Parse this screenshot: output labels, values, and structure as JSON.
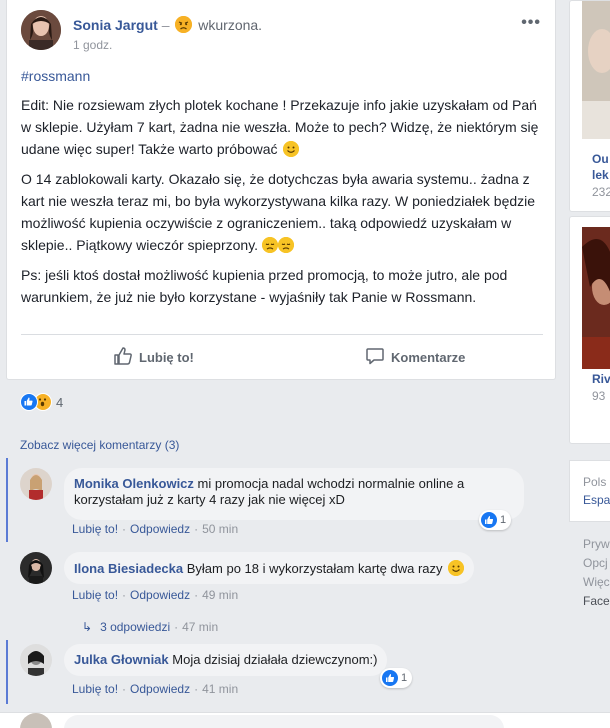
{
  "post": {
    "author": "Sonia Jargut",
    "feeling_dash": "–",
    "feeling": "wkurzona.",
    "timestamp": "1 godz.",
    "hashtag": "#rossmann",
    "paragraphs": [
      "Edit: Nie rozsiewam złych plotek kochane ! Przekazuje info jakie uzyskałam od Pań w sklepie. Użyłam 7 kart, żadna nie weszła. Może to pech? Widzę, że niektórym się udane więc super! Także warto próbować",
      "O 14 zablokowali karty. Okazało się, że dotychczas była awaria systemu.. żadna z kart nie weszła teraz mi, bo była wykorzystywana kilka razy. W poniedziałek będzie możliwość kupienia oczywiście z ograniczeniem.. taką odpowiedź uzyskałam w sklepie.. Piątkowy wieczór spieprzony.",
      "Ps: jeśli ktoś dostał możliwość kupienia przed promocją, to może jutro, ale pod warunkiem, że już nie było korzystane - wyjaśniły tak Panie w Rossmann."
    ],
    "like_label": "Lubię to!",
    "comment_label": "Komentarze",
    "reaction_count": "4"
  },
  "comments_section": {
    "more_comments": "Zobacz więcej komentarzy (3)",
    "action_like": "Lubię to!",
    "action_reply": "Odpowiedz",
    "sep": "·",
    "items": [
      {
        "name": "Monika Olenkowicz",
        "text": "mi promocja nadal wchodzi normalnie online a korzystałam już z karty 4 razy jak nie więcej xD",
        "time": "50 min",
        "likes": "1"
      },
      {
        "name": "Ilona Biesiadecka",
        "text": "Byłam po 18 i wykorzystałam kartę dwa razy",
        "time": "49 min"
      },
      {
        "name": "Julka Głowniak",
        "text": "Moja dzisiaj działała dziewczynom:)",
        "time": "41 min",
        "likes": "1"
      }
    ],
    "replies": {
      "label": "3 odpowiedzi",
      "sep": "·",
      "time": "47 min"
    }
  },
  "sidebar": {
    "card1": {
      "title_1": "Ou",
      "title_2": "lek",
      "sub": "232"
    },
    "card2": {
      "title": "Riv",
      "sub": "93"
    },
    "lang": {
      "line1": "Pols",
      "line2": "Espa"
    },
    "footer": [
      "Pryw",
      "Opcj",
      "Więc",
      "Face"
    ]
  },
  "colors": {
    "link": "#385898",
    "like_blue": "#1877f2",
    "wow_yellow": "#f7b125",
    "page_bg": "#e9ebee"
  }
}
